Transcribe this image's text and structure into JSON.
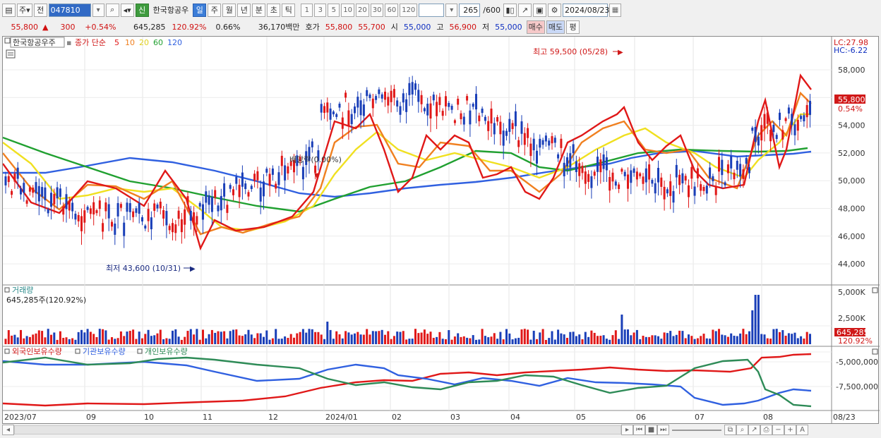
{
  "toolbar": {
    "period_type": "주",
    "prev_label": "전",
    "code": "047810",
    "name": "한국항공우",
    "badge": "신",
    "periods": [
      "일",
      "주",
      "월",
      "년",
      "분",
      "초",
      "틱"
    ],
    "minutes": [
      "1",
      "3",
      "5",
      "10",
      "20",
      "30",
      "60",
      "120"
    ],
    "count": "265",
    "count_total": "/600",
    "date": "2024/08/23"
  },
  "quote": {
    "price": "55,800",
    "change": "300",
    "change_pct": "+0.54%",
    "volume": "645,285",
    "vol_ratio": "120.92%",
    "turnover_pct": "0.66%",
    "amount": "36,170백만",
    "ask_label": "호가",
    "ask": "55,800",
    "bid": "55,700",
    "open_label": "시",
    "open": "55,000",
    "high_label": "고",
    "high": "56,900",
    "low_label": "저",
    "low": "55,000",
    "buy": "매수",
    "sell": "매도",
    "extra": "평"
  },
  "price_panel": {
    "stock_label": "한국항공우주",
    "ma_label": "종가 단순",
    "ma_periods": [
      "5",
      "10",
      "20",
      "60",
      "120"
    ],
    "ma_colors": [
      "#e01818",
      "#f08020",
      "#f0e020",
      "#20a030",
      "#3060e0"
    ],
    "lc": "LC:27.98",
    "hc": "HC:-6.22",
    "y_ticks": [
      "58,000",
      "56,000",
      "54,000",
      "52,000",
      "50,000",
      "48,000",
      "46,000",
      "44,000"
    ],
    "high_annotation": "최고 59,500 (05/28)",
    "low_annotation": "최저 43,600 (10/31)",
    "dividend_annotation": "배당락(0.00%)",
    "price_tag": "55,800",
    "pct_tag": "0.54%"
  },
  "volume_panel": {
    "title": "거래량",
    "value_label": "645,285주(120.92%)",
    "y_ticks": [
      "5,000K",
      "2,500K"
    ],
    "tag_value": "645,285",
    "tag_pct": "120.92%"
  },
  "holdings_panel": {
    "series": [
      "외국인보유수량",
      "기관보유수량",
      "개인보유수량"
    ],
    "colors": [
      "#e01818",
      "#3060e0",
      "#2e8b57"
    ],
    "y_ticks": [
      "-5,000,000",
      "-7,500,000"
    ]
  },
  "x_axis": [
    "2023/07",
    "09",
    "10",
    "11",
    "12",
    "2024/01",
    "02",
    "03",
    "04",
    "05",
    "06",
    "07",
    "08",
    "08/23"
  ]
}
